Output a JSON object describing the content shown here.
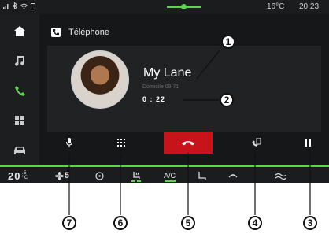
{
  "status_bar": {
    "outside_temp": "16°C",
    "clock": "20:23",
    "icons": [
      "signal-icon",
      "bluetooth-icon",
      "wifi-icon",
      "phone-small-icon"
    ]
  },
  "sidebar": {
    "items": [
      {
        "name": "home-icon"
      },
      {
        "name": "music-icon"
      },
      {
        "name": "phone-icon",
        "active": true
      },
      {
        "name": "apps-icon"
      },
      {
        "name": "car-icon"
      }
    ]
  },
  "header": {
    "title": "Téléphone"
  },
  "call": {
    "contact_name": "My Lane",
    "number_label": "Domicile  09 71",
    "timer": "0 : 22"
  },
  "actions": {
    "mic": "microphone-icon",
    "keypad": "keypad-icon",
    "hangup": "hang-up-icon",
    "transfer": "phone-transfer-icon",
    "hold": "pause-icon"
  },
  "climate": {
    "temp_value": "20",
    "temp_fraction": ".5",
    "temp_unit": "°C",
    "fan_level": "5",
    "ac_label": "A/C"
  },
  "callouts": [
    "1",
    "2",
    "3",
    "4",
    "5",
    "6",
    "7"
  ],
  "colors": {
    "accent": "#5fd34a",
    "hangup": "#c7141a",
    "background": "#0b0c0d"
  }
}
